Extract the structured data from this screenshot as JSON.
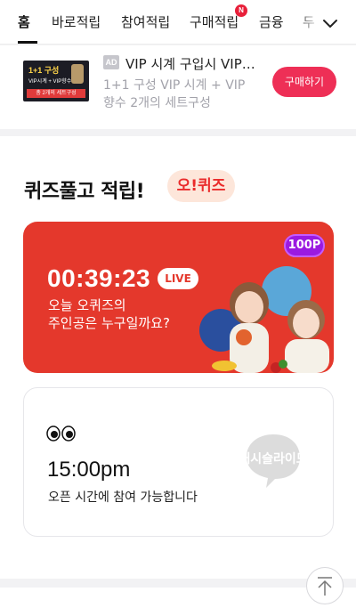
{
  "nav": {
    "tabs": [
      {
        "label": "홈"
      },
      {
        "label": "바로적립"
      },
      {
        "label": "참여적립"
      },
      {
        "label": "구매적립"
      },
      {
        "label": "금융"
      },
      {
        "label": "두"
      }
    ],
    "new_badge": "N"
  },
  "ad": {
    "thumb_line1": "1+1 구성",
    "thumb_line2": "VIP시계 + VIP향수",
    "thumb_line3": "총 2개의 세트구성",
    "badge": "AD",
    "title": "VIP 시계 구입시 VIP 향수",
    "description": "1+1 구성 VIP 시계 + VIP 향수 2개의 세트구성",
    "button_label": "구매하기"
  },
  "quiz": {
    "heading": "퀴즈풀고 적립!",
    "logo_text": "오!퀴즈",
    "live": {
      "points": "100P",
      "timer": "00:39:23",
      "live_label": "LIVE",
      "question_line1": "오늘 오퀴즈의",
      "question_line2": "주인공은 누구일까요?"
    },
    "upcoming": {
      "time": "15:00pm",
      "message": "오픈 시간에 참여 가능합니다",
      "brand_text": "캐시슬라이드"
    }
  },
  "colors": {
    "accent_red": "#e4382c",
    "button_pink": "#ee2f56",
    "badge_purple": "#9b1ae0",
    "logo_bg": "#fde6da"
  },
  "icons": [
    "chevron-down-icon",
    "eyes-icon",
    "scroll-top-arrow-icon",
    "brand-speech-icon"
  ]
}
